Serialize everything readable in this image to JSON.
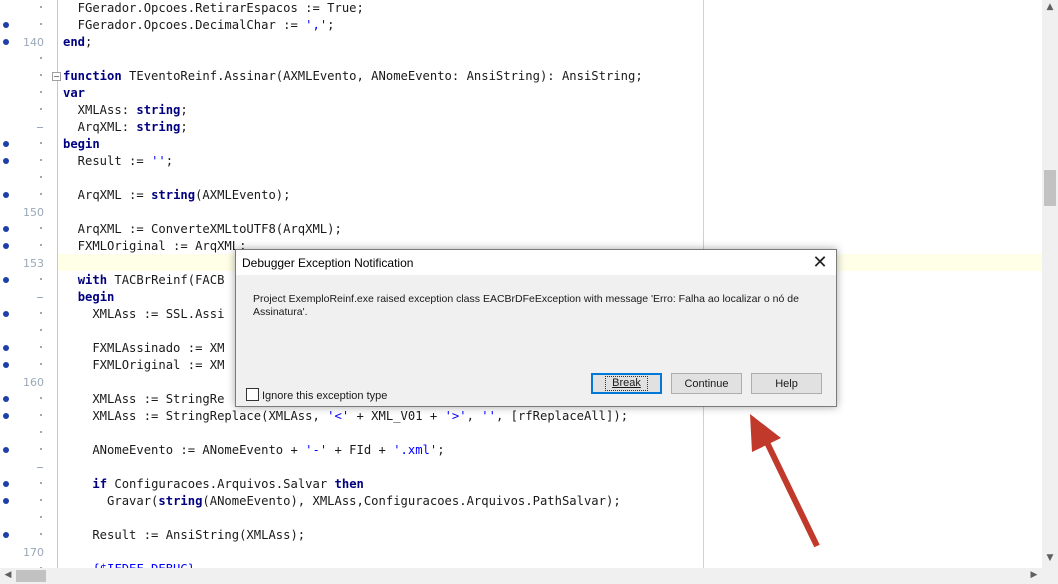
{
  "editor": {
    "lines": [
      {
        "bp": false,
        "gutter": "dot",
        "fold": false,
        "code": [
          [
            "t",
            "  FGerador.Opcoes.RetirarEspacos := True;"
          ]
        ]
      },
      {
        "bp": true,
        "gutter": "dot",
        "fold": false,
        "code": [
          [
            "t",
            "  FGerador.Opcoes.DecimalChar := "
          ],
          [
            "s",
            "','"
          ],
          [
            "t",
            ";"
          ]
        ]
      },
      {
        "bp": true,
        "gutter": "140",
        "fold": false,
        "code": [
          [
            "k",
            "end"
          ],
          [
            "t",
            ";"
          ]
        ]
      },
      {
        "bp": false,
        "gutter": "dot",
        "fold": false,
        "code": [
          [
            "t",
            ""
          ]
        ]
      },
      {
        "bp": false,
        "gutter": "dot",
        "fold": true,
        "code": [
          [
            "k",
            "function"
          ],
          [
            "t",
            " TEventoReinf.Assinar(AXMLEvento, ANomeEvento: AnsiString): AnsiString;"
          ]
        ]
      },
      {
        "bp": false,
        "gutter": "dot",
        "fold": false,
        "code": [
          [
            "k",
            "var"
          ]
        ]
      },
      {
        "bp": false,
        "gutter": "dot",
        "fold": false,
        "code": [
          [
            "t",
            "  XMLAss: "
          ],
          [
            "k",
            "string"
          ],
          [
            "t",
            ";"
          ]
        ]
      },
      {
        "bp": false,
        "gutter": "dash",
        "fold": false,
        "code": [
          [
            "t",
            "  ArqXML: "
          ],
          [
            "k",
            "string"
          ],
          [
            "t",
            ";"
          ]
        ]
      },
      {
        "bp": true,
        "gutter": "dot",
        "fold": false,
        "code": [
          [
            "k",
            "begin"
          ]
        ]
      },
      {
        "bp": true,
        "gutter": "dot",
        "fold": false,
        "code": [
          [
            "t",
            "  Result := "
          ],
          [
            "s",
            "''"
          ],
          [
            "t",
            ";"
          ]
        ]
      },
      {
        "bp": false,
        "gutter": "dot",
        "fold": false,
        "code": [
          [
            "t",
            ""
          ]
        ]
      },
      {
        "bp": true,
        "gutter": "dot",
        "fold": false,
        "code": [
          [
            "t",
            "  ArqXML := "
          ],
          [
            "k",
            "string"
          ],
          [
            "t",
            "(AXMLEvento);"
          ]
        ]
      },
      {
        "bp": false,
        "gutter": "150",
        "fold": false,
        "code": [
          [
            "t",
            ""
          ]
        ]
      },
      {
        "bp": true,
        "gutter": "dot",
        "fold": false,
        "code": [
          [
            "t",
            "  ArqXML := ConverteXMLtoUTF8(ArqXML);"
          ]
        ]
      },
      {
        "bp": true,
        "gutter": "dot",
        "fold": false,
        "code": [
          [
            "t",
            "  FXMLOriginal := ArqXML;"
          ]
        ]
      },
      {
        "bp": false,
        "gutter": "153",
        "fold": false,
        "code": [
          [
            "t",
            ""
          ]
        ]
      },
      {
        "bp": true,
        "gutter": "dot",
        "fold": false,
        "code": [
          [
            "t",
            "  "
          ],
          [
            "k",
            "with"
          ],
          [
            "t",
            " TACBrReinf(FACB"
          ]
        ]
      },
      {
        "bp": false,
        "gutter": "dash",
        "fold": false,
        "code": [
          [
            "t",
            "  "
          ],
          [
            "k",
            "begin"
          ]
        ]
      },
      {
        "bp": true,
        "gutter": "dot",
        "fold": false,
        "code": [
          [
            "t",
            "    XMLAss := SSL.Assi"
          ]
        ]
      },
      {
        "bp": false,
        "gutter": "dot",
        "fold": false,
        "code": [
          [
            "t",
            ""
          ]
        ]
      },
      {
        "bp": true,
        "gutter": "dot",
        "fold": false,
        "code": [
          [
            "t",
            "    FXMLAssinado := XM"
          ]
        ]
      },
      {
        "bp": true,
        "gutter": "dot",
        "fold": false,
        "code": [
          [
            "t",
            "    FXMLOriginal := XM"
          ]
        ]
      },
      {
        "bp": false,
        "gutter": "160",
        "fold": false,
        "code": [
          [
            "t",
            ""
          ]
        ]
      },
      {
        "bp": true,
        "gutter": "dot",
        "fold": false,
        "code": [
          [
            "t",
            "    XMLAss := StringRe"
          ]
        ]
      },
      {
        "bp": true,
        "gutter": "dot",
        "fold": false,
        "code": [
          [
            "t",
            "    XMLAss := StringReplace(XMLAss, "
          ],
          [
            "s",
            "'<'"
          ],
          [
            "t",
            " + XML_V01 + "
          ],
          [
            "s",
            "'>'"
          ],
          [
            "t",
            ", "
          ],
          [
            "s",
            "''"
          ],
          [
            "t",
            ", [rfReplaceAll]);"
          ]
        ]
      },
      {
        "bp": false,
        "gutter": "dot",
        "fold": false,
        "code": [
          [
            "t",
            ""
          ]
        ]
      },
      {
        "bp": true,
        "gutter": "dot",
        "fold": false,
        "code": [
          [
            "t",
            "    ANomeEvento := ANomeEvento + "
          ],
          [
            "s",
            "'-'"
          ],
          [
            "t",
            " + FId + "
          ],
          [
            "s",
            "'.xml'"
          ],
          [
            "t",
            ";"
          ]
        ]
      },
      {
        "bp": false,
        "gutter": "dash",
        "fold": false,
        "code": [
          [
            "t",
            ""
          ]
        ]
      },
      {
        "bp": true,
        "gutter": "dot",
        "fold": false,
        "code": [
          [
            "t",
            "    "
          ],
          [
            "k",
            "if"
          ],
          [
            "t",
            " Configuracoes.Arquivos.Salvar "
          ],
          [
            "k",
            "then"
          ]
        ]
      },
      {
        "bp": true,
        "gutter": "dot",
        "fold": false,
        "code": [
          [
            "t",
            "      Gravar("
          ],
          [
            "k",
            "string"
          ],
          [
            "t",
            "(ANomeEvento), XMLAss,Configuracoes.Arquivos.PathSalvar);"
          ]
        ]
      },
      {
        "bp": false,
        "gutter": "dot",
        "fold": false,
        "code": [
          [
            "t",
            ""
          ]
        ]
      },
      {
        "bp": true,
        "gutter": "dot",
        "fold": false,
        "code": [
          [
            "t",
            "    Result := AnsiString(XMLAss);"
          ]
        ]
      },
      {
        "bp": false,
        "gutter": "170",
        "fold": false,
        "code": [
          [
            "t",
            ""
          ]
        ]
      },
      {
        "bp": false,
        "gutter": "dot",
        "fold": false,
        "code": [
          [
            "s",
            "    {$IFDEF DEBUG}"
          ]
        ]
      }
    ]
  },
  "dialog": {
    "title": "Debugger Exception Notification",
    "close_icon": "close-icon",
    "message": "Project ExemploReinf.exe raised exception class EACBrDFeException with message 'Erro: Falha ao localizar o nó de Assinatura'.",
    "checkbox_label": "Ignore this exception type",
    "buttons": {
      "break_label": "Break",
      "continue_label": "Continue",
      "help_label": "Help"
    }
  },
  "colors": {
    "keyword": "#000080",
    "string": "#0000ff",
    "breakpoint": "#1e3fa8",
    "annotation_arrow": "#c0392b",
    "default_button_border": "#0078d7"
  },
  "icons": {
    "scroll_up": "scroll-up-arrow-icon",
    "scroll_down": "scroll-down-arrow-icon",
    "scroll_left": "scroll-left-arrow-icon",
    "scroll_right": "scroll-right-arrow-icon",
    "annotation": "red-arrow-annotation-icon"
  }
}
